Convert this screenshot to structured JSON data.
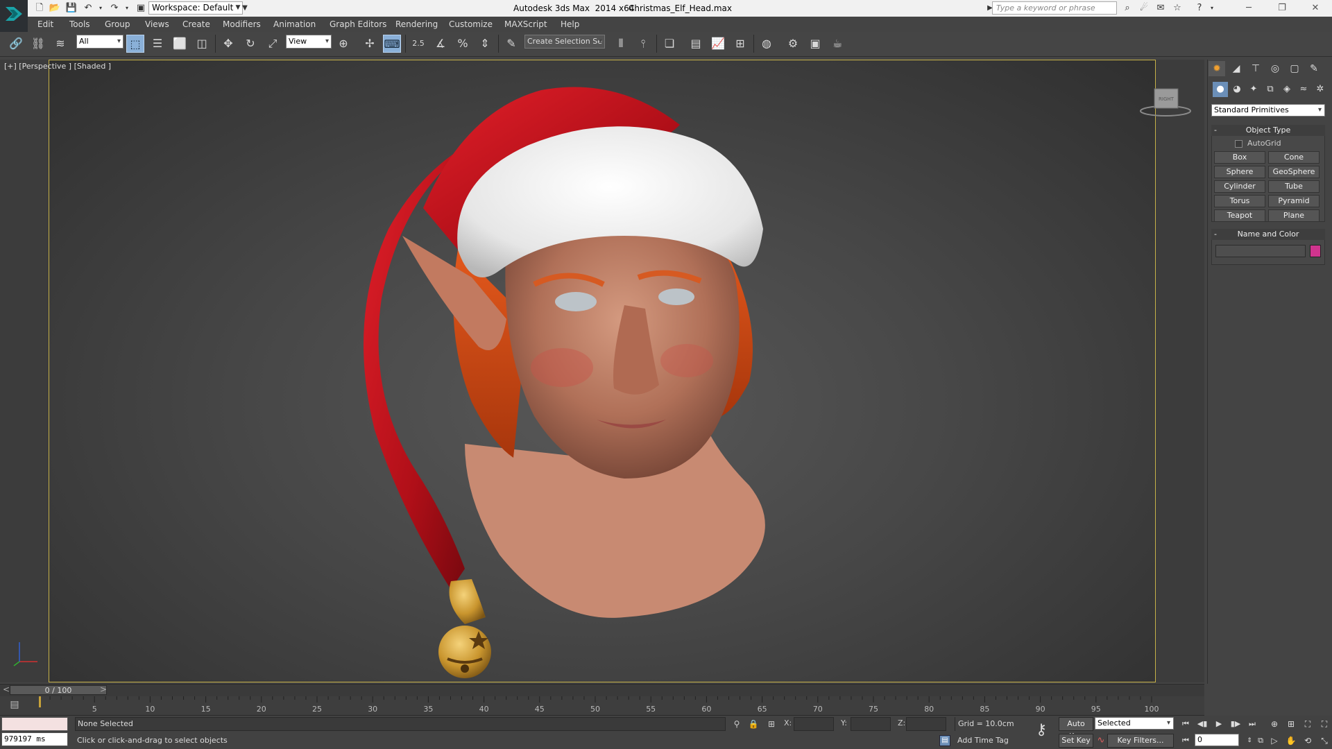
{
  "app": {
    "title": "Autodesk 3ds Max  2014 x64",
    "file": "Christmas_Elf_Head.max",
    "workspace": "Workspace: Default",
    "search_placeholder": "Type a keyword or phrase"
  },
  "menu": [
    "Edit",
    "Tools",
    "Group",
    "Views",
    "Create",
    "Modifiers",
    "Animation",
    "Graph Editors",
    "Rendering",
    "Customize",
    "MAXScript",
    "Help"
  ],
  "toolbar": {
    "filter": "All",
    "ref_coord": "View",
    "snap_angle": "2.5",
    "named_selection": "Create Selection Se"
  },
  "viewport": {
    "label": "[+] [Perspective ] [Shaded ]",
    "viewcube_face": "RIGHT"
  },
  "command_panel": {
    "category": "Standard Primitives",
    "object_type_title": "Object Type",
    "autogrid": "AutoGrid",
    "buttons": [
      "Box",
      "Cone",
      "Sphere",
      "GeoSphere",
      "Cylinder",
      "Tube",
      "Torus",
      "Pyramid",
      "Teapot",
      "Plane"
    ],
    "name_color_title": "Name and Color",
    "swatch_color": "#d0348e"
  },
  "timeline": {
    "position": "0 / 100",
    "prev": "<",
    "next": ">",
    "ticks": [
      "5",
      "10",
      "15",
      "20",
      "25",
      "30",
      "35",
      "40",
      "45",
      "50",
      "55",
      "60",
      "65",
      "70",
      "75",
      "80",
      "85",
      "90",
      "95",
      "100"
    ]
  },
  "status": {
    "render_time": "979197 ms",
    "selection": "None Selected",
    "prompt": "Click or click-and-drag to select objects",
    "x_label": "X:",
    "y_label": "Y:",
    "z_label": "Z:",
    "grid": "Grid = 10.0cm",
    "add_time_tag": "Add Time Tag",
    "auto_key": "Auto Key",
    "set_key": "Set Key",
    "key_mode": "Selected",
    "key_filters": "Key Filters...",
    "frame": "0"
  }
}
